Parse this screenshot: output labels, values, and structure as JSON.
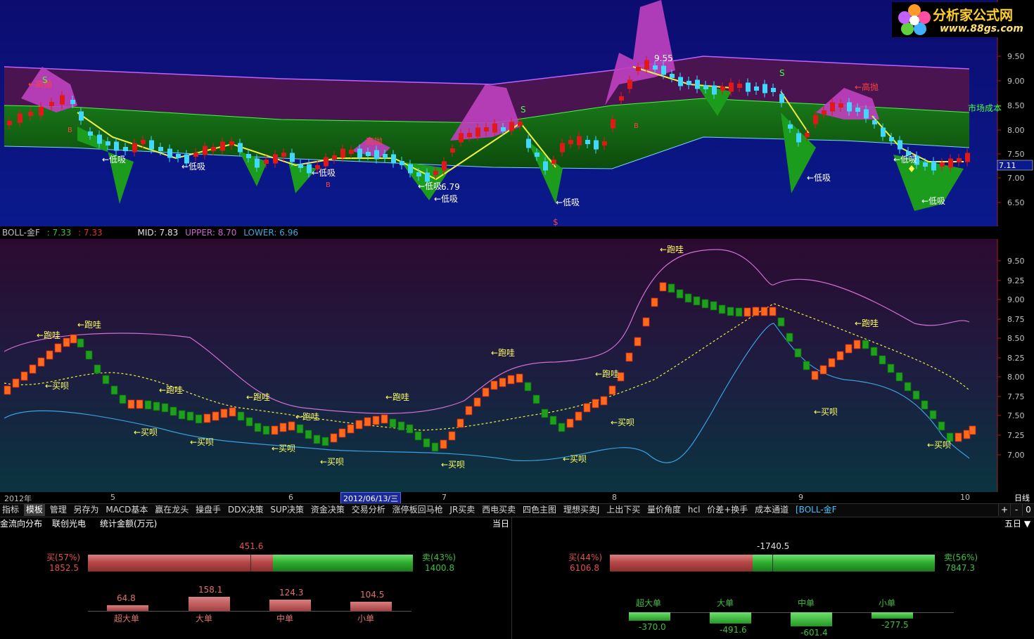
{
  "watermark": {
    "title": "分析家公式网",
    "url": "www.88gs.com"
  },
  "top_chart": {
    "price_ticks": [
      "9.50",
      "9.00",
      "8.50",
      "8.00",
      "7.50",
      "7.00",
      "6.50"
    ],
    "current_price_label": "7.11",
    "market_cost_label": "市场成本",
    "annotations": {
      "gaopao": "←高抛",
      "gaopao2": "高抛",
      "dixi": "←低吸",
      "high_value": "9.55",
      "low_value": "6.79",
      "signal_s": "S",
      "signal_b": "B",
      "signal_dollar": "$"
    }
  },
  "boll_header": {
    "name": "BOLL-金F",
    "v1": ": 7.33",
    "v2": ": 7.33",
    "mid": "MID: 7.83",
    "upper": "UPPER: 8.70",
    "lower": "LOWER: 6.96",
    "colors": {
      "name": "#c0c0c0",
      "v1": "#3cc03c",
      "v2": "#e03030",
      "mid": "#e0e0e0",
      "upper": "#d060d0",
      "lower": "#3aa8e0"
    }
  },
  "bottom_chart": {
    "price_ticks": [
      "9.50",
      "9.25",
      "9.00",
      "8.75",
      "8.50",
      "8.25",
      "8.00",
      "7.75",
      "7.50",
      "7.25",
      "7.00"
    ],
    "labels": {
      "paowa": "←跑哇",
      "maibei": "←买呗"
    }
  },
  "date_axis": {
    "ticks": [
      "2012年",
      "5",
      "6",
      "7",
      "8",
      "9",
      "10"
    ],
    "cursor_date": "2012/06/13/三",
    "period": "日线"
  },
  "tabs": [
    "指标",
    "模板",
    "管理",
    "另存为",
    "MACD基本",
    "赢在龙头",
    "操盘手",
    "DDX决策",
    "SUP决策",
    "资金决策",
    "交易分析",
    "涨停板回马枪",
    "JR买卖",
    "西电买卖",
    "四色主图",
    "理想买卖J",
    "上出下买",
    "量价角度",
    "hcl",
    "价差+换手",
    "成本通道",
    "[BOLL-金F"
  ],
  "tab_controls": [
    "+",
    "-",
    "0"
  ],
  "fund_header": {
    "title": "金流向分布",
    "stock": "联创光电",
    "unit": "统计金额(万元)",
    "left_period": "当日",
    "right_period": "五日 ▼"
  },
  "fund_left": {
    "net": "451.6",
    "buy_label": "买(57%)",
    "buy_value": "1852.5",
    "sell_label": "卖(43%)",
    "sell_value": "1400.8",
    "buy_fraction": 0.57,
    "categories": [
      {
        "name": "超大单",
        "value": "64.8"
      },
      {
        "name": "大单",
        "value": "158.1"
      },
      {
        "name": "中单",
        "value": "124.3"
      },
      {
        "name": "小单",
        "value": "104.5"
      }
    ]
  },
  "fund_right": {
    "net": "-1740.5",
    "buy_label": "买(44%)",
    "buy_value": "6106.8",
    "sell_label": "卖(56%)",
    "sell_value": "7847.3",
    "buy_fraction": 0.44,
    "categories": [
      {
        "name": "超大单",
        "value": "-370.0"
      },
      {
        "name": "大单",
        "value": "-491.6"
      },
      {
        "name": "中单",
        "value": "-601.4"
      },
      {
        "name": "小单",
        "value": "-277.5"
      }
    ]
  }
}
